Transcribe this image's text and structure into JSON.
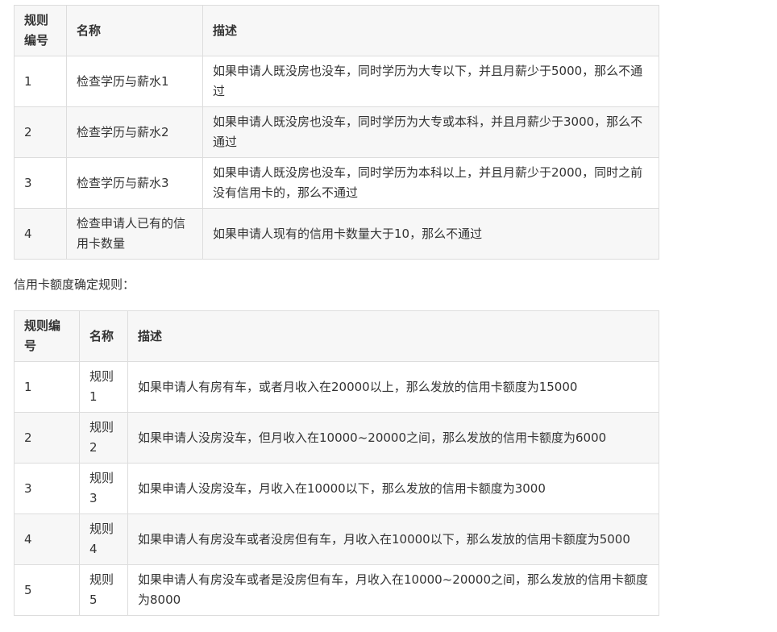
{
  "table1": {
    "headers": [
      "规则编号",
      "名称",
      "描述"
    ],
    "rows": [
      {
        "id": "1",
        "name": "检查学历与薪水1",
        "desc": "如果申请人既没房也没车，同时学历为大专以下，并且月薪少于5000，那么不通过"
      },
      {
        "id": "2",
        "name": "检查学历与薪水2",
        "desc": "如果申请人既没房也没车，同时学历为大专或本科，并且月薪少于3000，那么不通过"
      },
      {
        "id": "3",
        "name": "检查学历与薪水3",
        "desc": "如果申请人既没房也没车，同时学历为本科以上，并且月薪少于2000，同时之前没有信用卡的，那么不通过"
      },
      {
        "id": "4",
        "name": "检查申请人已有的信用卡数量",
        "desc": "如果申请人现有的信用卡数量大于10，那么不通过"
      }
    ]
  },
  "caption": "信用卡额度确定规则：",
  "table2": {
    "headers": [
      "规则编号",
      "名称",
      "描述"
    ],
    "rows": [
      {
        "id": "1",
        "name": "规则1",
        "desc": "如果申请人有房有车，或者月收入在20000以上，那么发放的信用卡额度为15000"
      },
      {
        "id": "2",
        "name": "规则2",
        "desc": "如果申请人没房没车，但月收入在10000~20000之间，那么发放的信用卡额度为6000"
      },
      {
        "id": "3",
        "name": "规则3",
        "desc": "如果申请人没房没车，月收入在10000以下，那么发放的信用卡额度为3000"
      },
      {
        "id": "4",
        "name": "规则4",
        "desc": "如果申请人有房没车或者没房但有车，月收入在10000以下，那么发放的信用卡额度为5000"
      },
      {
        "id": "5",
        "name": "规则5",
        "desc": "如果申请人有房没车或者是没房但有车，月收入在10000~20000之间，那么发放的信用卡额度为8000"
      }
    ]
  }
}
